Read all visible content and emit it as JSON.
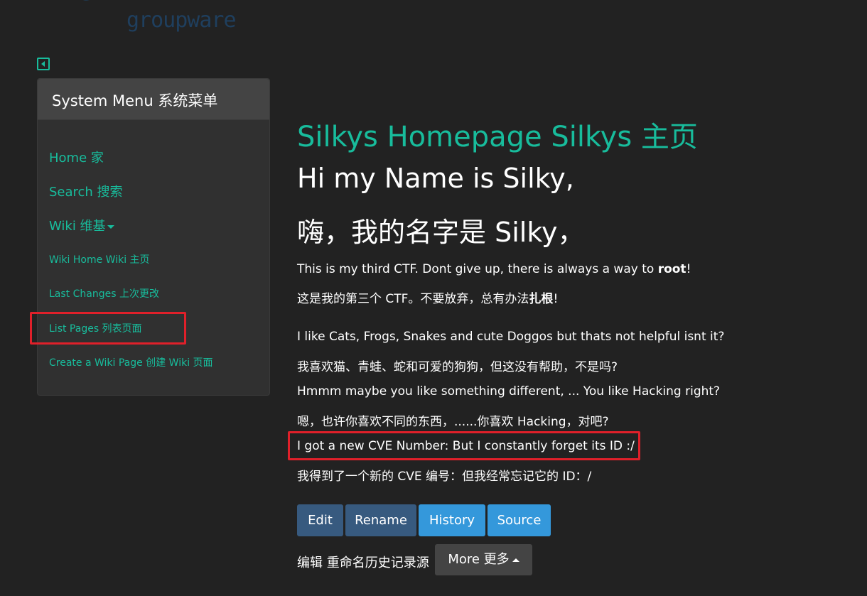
{
  "logo": {
    "line1": "cms",
    "line2": "groupware"
  },
  "sidebar": {
    "title": "System Menu  系统菜单",
    "items": [
      {
        "label": "Home  家"
      },
      {
        "label": "Search  搜索"
      },
      {
        "label": "Wiki  维基"
      }
    ],
    "wiki_items": [
      {
        "label": "Wiki Home  Wiki 主页"
      },
      {
        "label": "Last Changes  上次更改"
      },
      {
        "label": "List Pages  列表页面"
      },
      {
        "label": "Create a Wiki Page  创建 Wiki 页面"
      }
    ]
  },
  "main": {
    "title": "Silkys Homepage  Silkys 主页",
    "heading_line1": "Hi my Name is Silky,",
    "heading_line2": "嗨，我的名字是 Silky，",
    "intro_pre": "This is my third CTF. Dont give up, there is always a way to ",
    "intro_bold": "root",
    "intro_post": "!",
    "intro_cn_pre": "这是我的第三个 CTF。不要放弃，总有办法",
    "intro_cn_bold": "扎根",
    "intro_cn_post": "!",
    "p1": "I like Cats, Frogs, Snakes and cute Doggos but thats not helpful isnt it?",
    "p1_cn": "我喜欢猫、青蛙、蛇和可爱的狗狗，但这没有帮助，不是吗?",
    "p2": "Hmmm maybe you like something different, ... You like Hacking right?",
    "p2_cn": "嗯，也许你喜欢不同的东西，......你喜欢 Hacking，对吧?",
    "p3": "I got a new CVE Number: But I constantly forget its ID :/",
    "p3_cn": "我得到了一个新的 CVE 编号：但我经常忘记它的 ID：/"
  },
  "buttons": {
    "edit": "Edit",
    "rename": "Rename",
    "history": "History",
    "source": "Source",
    "cn_labels": "编辑 重命名历史记录源",
    "more": "More  更多"
  },
  "colors": {
    "background": "#222222",
    "accent": "#18bc9c",
    "btn_dark": "#375a7f",
    "btn_light": "#3498db",
    "highlight": "#e0202a"
  }
}
